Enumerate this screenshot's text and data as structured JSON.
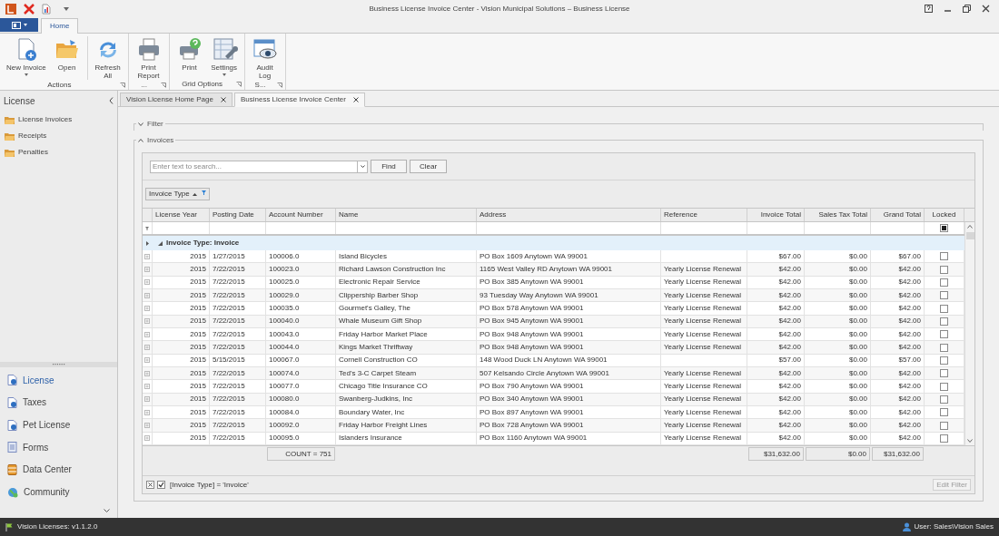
{
  "window": {
    "title": "Business License Invoice Center - Vision Municipal Solutions – Business License"
  },
  "ribbon": {
    "tabs": [
      {
        "label": "Home",
        "selected": true
      }
    ],
    "groups": [
      {
        "label": "Actions",
        "buttons": [
          {
            "label": "New Invoice",
            "dropdown": true,
            "separated": false
          },
          {
            "label": "Open",
            "dropdown": false,
            "separated": false
          },
          {
            "label": "Refresh\nAll",
            "dropdown": false,
            "separated": true
          }
        ]
      },
      {
        "label": "...",
        "buttons": [
          {
            "label": "Print\nReport",
            "dropdown": false,
            "separated": false
          }
        ]
      },
      {
        "label": "Grid Options",
        "buttons": [
          {
            "label": "Print",
            "dropdown": false,
            "separated": false
          },
          {
            "label": "Settings",
            "dropdown": true,
            "separated": false
          }
        ]
      },
      {
        "label": "S...",
        "buttons": [
          {
            "label": "Audit\nLog",
            "dropdown": false,
            "separated": false
          }
        ]
      }
    ]
  },
  "sidebar": {
    "title": "License",
    "items": [
      {
        "label": "License Invoices"
      },
      {
        "label": "Receipts"
      },
      {
        "label": "Penalties"
      }
    ],
    "groups": [
      {
        "label": "License",
        "selected": true
      },
      {
        "label": "Taxes",
        "selected": false
      },
      {
        "label": "Pet License",
        "selected": false
      },
      {
        "label": "Forms",
        "selected": false
      },
      {
        "label": "Data Center",
        "selected": false
      },
      {
        "label": "Community",
        "selected": false
      }
    ]
  },
  "document_tabs": [
    {
      "label": "Vision License Home Page",
      "selected": false
    },
    {
      "label": "Business License Invoice Center",
      "selected": true
    }
  ],
  "filter_section": {
    "label": "Filter",
    "expanded": false
  },
  "invoices_section": {
    "label": "Invoices",
    "expanded": true,
    "search": {
      "placeholder": "Enter text to search...",
      "find": "Find",
      "clear": "Clear"
    },
    "group_by": {
      "label": "Invoice Type"
    },
    "columns": [
      {
        "label": "License Year",
        "kind": "number"
      },
      {
        "label": "Posting Date",
        "kind": "text"
      },
      {
        "label": "Account Number",
        "kind": "text"
      },
      {
        "label": "Name",
        "kind": "text"
      },
      {
        "label": "Address",
        "kind": "text"
      },
      {
        "label": "Reference",
        "kind": "text"
      },
      {
        "label": "Invoice Total",
        "kind": "number"
      },
      {
        "label": "Sales Tax Total",
        "kind": "number"
      },
      {
        "label": "Grand Total",
        "kind": "number"
      },
      {
        "label": "Locked",
        "kind": "check"
      }
    ],
    "locked_filter_indeterminate": true,
    "group": {
      "label": "Invoice Type: Invoice",
      "expanded": true
    },
    "rows": [
      {
        "year": "2015",
        "date": "1/27/2015",
        "account": "100006.0",
        "name": "Island Bicycles",
        "address": "PO Box 1609 Anytown WA 99001",
        "invoice_total": "$67.00",
        "sales_tax_total": "$0.00",
        "grand_total": "$67.00",
        "locked": false
      },
      {
        "year": "2015",
        "date": "7/22/2015",
        "account": "100023.0",
        "name": "Richard Lawson Construction Inc",
        "address": "1165 West Valley RD Anytown WA 99001",
        "reference": "Yearly License Renewal",
        "invoice_total": "$42.00",
        "sales_tax_total": "$0.00",
        "grand_total": "$42.00",
        "locked": false
      },
      {
        "year": "2015",
        "date": "7/22/2015",
        "account": "100025.0",
        "name": "Electronic Repair Service",
        "address": "PO Box 385 Anytown WA 99001",
        "reference": "Yearly License Renewal",
        "invoice_total": "$42.00",
        "sales_tax_total": "$0.00",
        "grand_total": "$42.00",
        "locked": false
      },
      {
        "year": "2015",
        "date": "7/22/2015",
        "account": "100029.0",
        "name": "Clippership Barber Shop",
        "address": "93 Tuesday Way Anytown WA 99001",
        "reference": "Yearly License Renewal",
        "invoice_total": "$42.00",
        "sales_tax_total": "$0.00",
        "grand_total": "$42.00",
        "locked": false
      },
      {
        "year": "2015",
        "date": "7/22/2015",
        "account": "100035.0",
        "name": "Gourmet's Galley, The",
        "address": "PO Box 578 Anytown WA 99001",
        "reference": "Yearly License Renewal",
        "invoice_total": "$42.00",
        "sales_tax_total": "$0.00",
        "grand_total": "$42.00",
        "locked": false
      },
      {
        "year": "2015",
        "date": "7/22/2015",
        "account": "100040.0",
        "name": "Whale Museum Gift Shop",
        "address": "PO Box 945 Anytown WA 99001",
        "reference": "Yearly License Renewal",
        "invoice_total": "$42.00",
        "sales_tax_total": "$0.00",
        "grand_total": "$42.00",
        "locked": false
      },
      {
        "year": "2015",
        "date": "7/22/2015",
        "account": "100043.0",
        "name": "Friday Harbor Market Place",
        "address": "PO Box 948 Anytown WA 99001",
        "reference": "Yearly License Renewal",
        "invoice_total": "$42.00",
        "sales_tax_total": "$0.00",
        "grand_total": "$42.00",
        "locked": false
      },
      {
        "year": "2015",
        "date": "7/22/2015",
        "account": "100044.0",
        "name": "Kings Market Thriftway",
        "address": "PO Box 948 Anytown WA 99001",
        "reference": "Yearly License Renewal",
        "invoice_total": "$42.00",
        "sales_tax_total": "$0.00",
        "grand_total": "$42.00",
        "locked": false
      },
      {
        "year": "2015",
        "date": "5/15/2015",
        "account": "100067.0",
        "name": "Cornell Construction CO",
        "address": "148 Wood Duck LN Anytown WA 99001",
        "invoice_total": "$57.00",
        "sales_tax_total": "$0.00",
        "grand_total": "$57.00",
        "locked": false
      },
      {
        "year": "2015",
        "date": "7/22/2015",
        "account": "100074.0",
        "name": "Ted's 3-C Carpet Steam",
        "address": "507 Kelsando Circle Anytown WA 99001",
        "reference": "Yearly License Renewal",
        "invoice_total": "$42.00",
        "sales_tax_total": "$0.00",
        "grand_total": "$42.00",
        "locked": false
      },
      {
        "year": "2015",
        "date": "7/22/2015",
        "account": "100077.0",
        "name": "Chicago Title Insurance CO",
        "address": "PO Box 790 Anytown WA 99001",
        "reference": "Yearly License Renewal",
        "invoice_total": "$42.00",
        "sales_tax_total": "$0.00",
        "grand_total": "$42.00",
        "locked": false
      },
      {
        "year": "2015",
        "date": "7/22/2015",
        "account": "100080.0",
        "name": "Swanberg-Judkins, Inc",
        "address": "PO Box 340 Anytown WA 99001",
        "reference": "Yearly License Renewal",
        "invoice_total": "$42.00",
        "sales_tax_total": "$0.00",
        "grand_total": "$42.00",
        "locked": false
      },
      {
        "year": "2015",
        "date": "7/22/2015",
        "account": "100084.0",
        "name": "Boundary Water, Inc",
        "address": "PO Box 897 Anytown WA 99001",
        "reference": "Yearly License Renewal",
        "invoice_total": "$42.00",
        "sales_tax_total": "$0.00",
        "grand_total": "$42.00",
        "locked": false
      },
      {
        "year": "2015",
        "date": "7/22/2015",
        "account": "100092.0",
        "name": "Friday Harbor Freight Lines",
        "address": "PO Box 728 Anytown WA 99001",
        "reference": "Yearly License Renewal",
        "invoice_total": "$42.00",
        "sales_tax_total": "$0.00",
        "grand_total": "$42.00",
        "locked": false
      },
      {
        "year": "2015",
        "date": "7/22/2015",
        "account": "100095.0",
        "name": "Islanders Insurance",
        "address": "PO Box 1160 Anytown WA 99001",
        "reference": "Yearly License Renewal",
        "invoice_total": "$42.00",
        "sales_tax_total": "$0.00",
        "grand_total": "$42.00",
        "locked": false
      }
    ],
    "totals": {
      "count": "COUNT = 751",
      "invoice_total": "$31,632.00",
      "sales_tax_total": "$0.00",
      "grand_total": "$31,632.00"
    },
    "filter_bar": {
      "expression": "[Invoice Type] = 'Invoice'",
      "enabled": true,
      "edit_button": {
        "label": "Edit Filter",
        "disabled": true
      }
    }
  },
  "status_bar": {
    "version": "Vision Licenses: v1.1.2.0",
    "user": "User: Sales\\Vision Sales"
  }
}
